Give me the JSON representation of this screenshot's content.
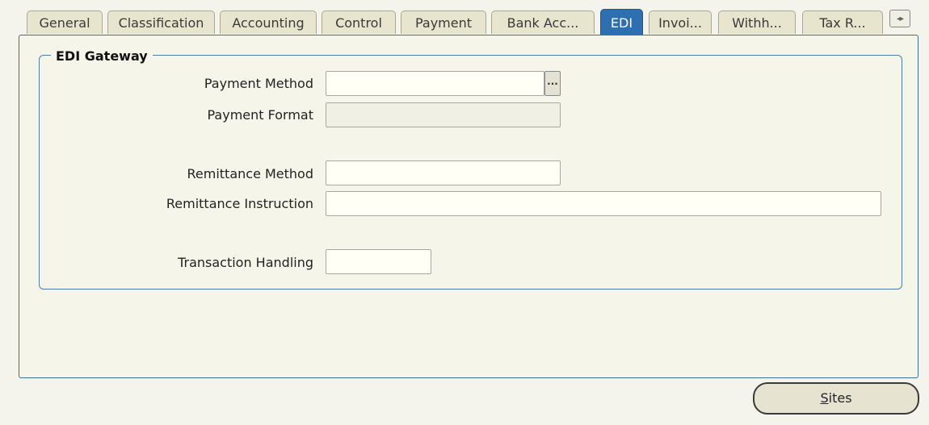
{
  "tabs": [
    {
      "label": "General"
    },
    {
      "label": "Classification"
    },
    {
      "label": "Accounting"
    },
    {
      "label": "Control"
    },
    {
      "label": "Payment"
    },
    {
      "label": "Bank Acc..."
    },
    {
      "label": "EDI"
    },
    {
      "label": "Invoi..."
    },
    {
      "label": "Withh..."
    },
    {
      "label": "Tax R..."
    }
  ],
  "active_tab": "EDI",
  "group": {
    "title": "EDI Gateway"
  },
  "fields": {
    "payment_method": {
      "label": "Payment Method",
      "value": ""
    },
    "payment_format": {
      "label": "Payment Format",
      "value": ""
    },
    "remittance_method": {
      "label": "Remittance Method",
      "value": ""
    },
    "remittance_instruction": {
      "label": "Remittance Instruction",
      "value": ""
    },
    "transaction_handling": {
      "label": "Transaction Handling",
      "value": ""
    }
  },
  "lov_button": {
    "label": "..."
  },
  "sites_button": {
    "mnemonic": "S",
    "rest": "ites"
  },
  "colors": {
    "active_tab": "#2d6fb0",
    "panel_border": "#3f6f9a",
    "background": "#f4f4ec"
  }
}
